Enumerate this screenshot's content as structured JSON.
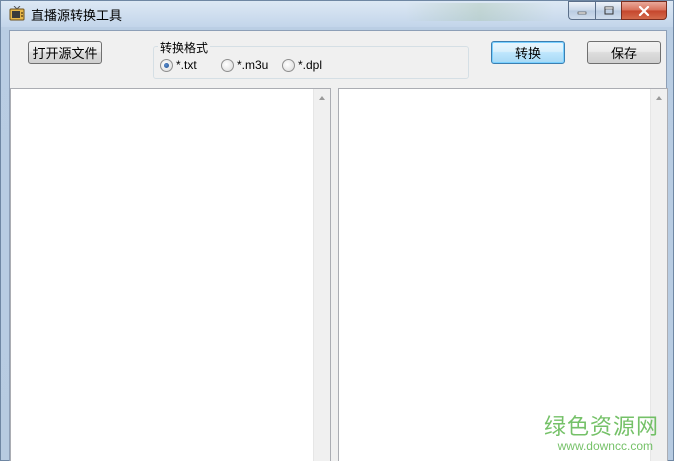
{
  "window": {
    "title": "直播源转换工具",
    "icons": {
      "app": "tv-icon",
      "minimize": "minimize-icon",
      "maximize": "maximize-icon",
      "close": "close-icon"
    }
  },
  "toolbar": {
    "open_label": "打开源文件",
    "convert_label": "转换",
    "save_label": "保存"
  },
  "format_group": {
    "label": "转换格式",
    "options": [
      {
        "label": "*.txt",
        "selected": true
      },
      {
        "label": "*.m3u",
        "selected": false
      },
      {
        "label": "*.dpl",
        "selected": false
      }
    ]
  },
  "panes": {
    "source_text": "",
    "result_text": ""
  },
  "watermark": {
    "main": "绿色资源网",
    "sub": "www.downcc.com"
  },
  "colors": {
    "accent": "#3c7fb1",
    "watermark": "#5db74e",
    "close_button": "#c4452c"
  }
}
